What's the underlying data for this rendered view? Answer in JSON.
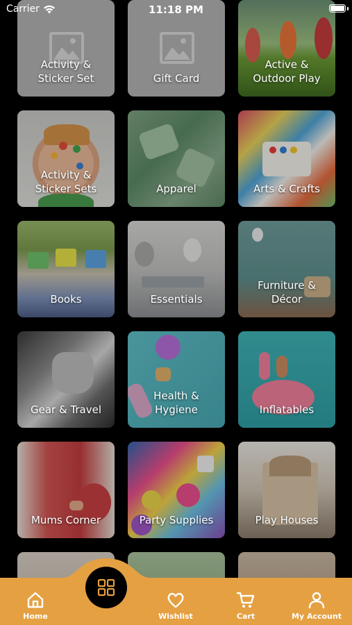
{
  "status_bar": {
    "carrier": "Carrier",
    "time": "11:18 PM"
  },
  "categories": [
    {
      "label": "Activity &\nSticker Set",
      "art": "placeholder-image"
    },
    {
      "label": "Gift Card",
      "art": "placeholder-image"
    },
    {
      "label": "Active &\nOutdoor Play",
      "art": "kids-running-photo"
    },
    {
      "label": "Activity &\nSticker Sets",
      "art": "child-face-stickers-photo"
    },
    {
      "label": "Apparel",
      "art": "green-paper-clothes-photo"
    },
    {
      "label": "Arts & Crafts",
      "art": "art-supplies-photo"
    },
    {
      "label": "Books",
      "art": "kids-reading-photo"
    },
    {
      "label": "Essentials",
      "art": "nursery-photo"
    },
    {
      "label": "Furniture &\nDécor",
      "art": "kids-room-photo"
    },
    {
      "label": "Gear & Travel",
      "art": "car-seat-photo"
    },
    {
      "label": "Health &\nHygiene",
      "art": "bath-toys-photo"
    },
    {
      "label": "Inflatables",
      "art": "flamingo-float-photo"
    },
    {
      "label": "Mums Corner",
      "art": "pregnant-mum-photo"
    },
    {
      "label": "Party Supplies",
      "art": "party-confetti-photo"
    },
    {
      "label": "Play Houses",
      "art": "dollhouse-photo"
    }
  ],
  "tab_bar": {
    "background": "#e5a042",
    "center_icon": "grid-icon",
    "tabs": [
      {
        "label": "Home",
        "icon": "home-icon"
      },
      {
        "label": "Wishlist",
        "icon": "heart-icon"
      },
      {
        "label": "Cart",
        "icon": "cart-icon"
      },
      {
        "label": "My Account",
        "icon": "user-icon"
      }
    ]
  }
}
